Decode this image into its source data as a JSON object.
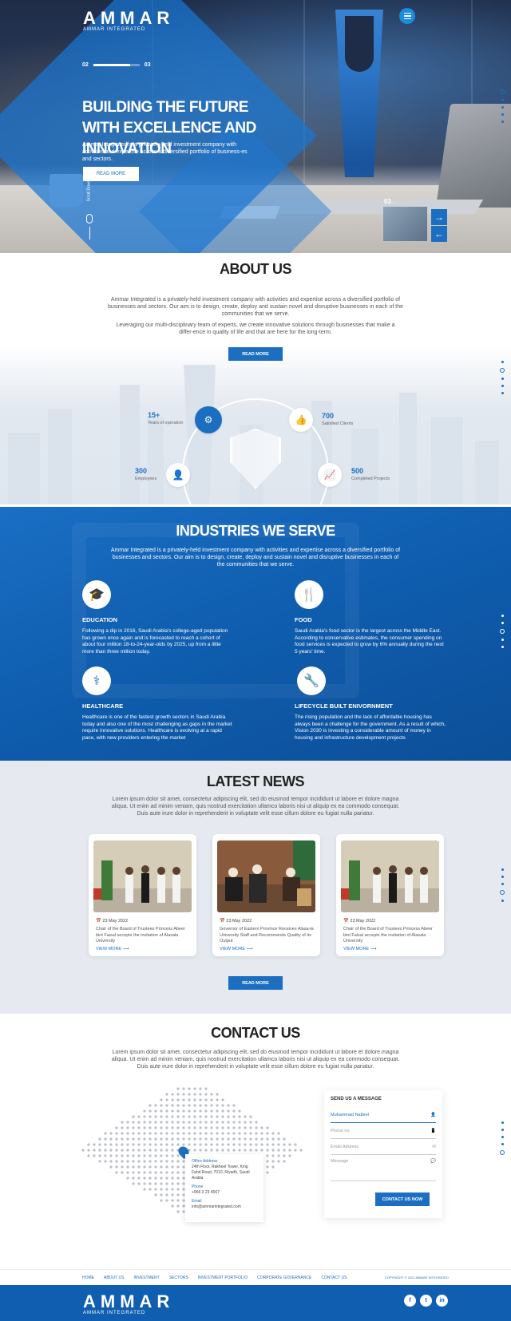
{
  "brand": {
    "name": "AMMAR",
    "tagline": "AMMAR INTEGRATED"
  },
  "hero": {
    "slide_current": "02",
    "slide_next": "03",
    "slide_progress": 0.8,
    "title": "Building the Future with Excellence and Innovation",
    "description": "Ammar Integrated is a privately-held investment company with activities and expertise across a diversified portfolio of business-es and sectors.",
    "cta": "READ MORE",
    "scroll_label": "Scroll Down",
    "thumb_number": "03 .",
    "next_icon": "arrow-right",
    "prev_icon": "arrow-left"
  },
  "about": {
    "title": "ABOUT US",
    "p1": "Ammar Integrated is a privately-held investment company with activities and expertise across a diversified portfolio of businesses and sectors. Our aim is to design, create, deploy and sustain novel and disruptive businesses in each of the communities that we serve.",
    "p2": "Leveraging our multi-disciplinary team of experts, we create innovative solutions through businesses that make a differ-ence in quality of life and that are here for the long-term.",
    "cta": "READ MORE",
    "stats": [
      {
        "value": "15+",
        "label": "Years of operation"
      },
      {
        "value": "700",
        "label": "Satisfied Clients"
      },
      {
        "value": "300",
        "label": "Employees"
      },
      {
        "value": "500",
        "label": "Completed Projects"
      }
    ]
  },
  "industries": {
    "title": "INDUSTRIES WE SERVE",
    "intro": "Ammar Integrated is a privately-held investment company with activities and expertise across a diversified portfolio of businesses and sectors. Our aim is to design, create, deploy and sustain novel and disruptive businesses in each of the communities that we serve.",
    "items": [
      {
        "title": "EDUCATION",
        "text": "Following a dip in 2016, Saudi Arabia's college-aged population has grown once again and is forecasted to reach a cohort of about four million 18-to-24-year-olds by 2025, up from a little more than three million today."
      },
      {
        "title": "FOOD",
        "text": "Saudi Arabia's food sector is the largest across the Middle East. According to conservative estimates, the consumer spending on food services is expected to grow by 6% annually during the next 5 years' time."
      },
      {
        "title": "HEALTHCARE",
        "text": "Healthcare is one of the fastest growth sectors in Saudi Arabia today and also one of the most challenging as gaps in the market require innovative solutions. Healthcare is evolving at a rapid pace, with new providers entering the market"
      },
      {
        "title": "LIFECYCLE BUILT ENIVORNMENT",
        "text": "The rising population and the lack of affordable housing has always been a challenge for the government. As a result of which, Vision 2030 is investing a considerable amount of money in housing and infrastructure development projects"
      }
    ]
  },
  "news": {
    "title": "LATEST NEWS",
    "intro": "Lorem ipsum dolor sit amet, consectetur adipiscing elit, sed do eiusmod tempor incididunt ut labore et dolore magna aliqua. Ut enim ad minim veniam, quis nostrud exercitation ullamco laboris nisi ut aliquip ex ea commodo consequat. Duis aute irure dolor in reprehenderit in voluptate velit esse cillum dolore eu fugiat nulla pariatur.",
    "cards": [
      {
        "date": "23 May 2022",
        "title": "Chair of the Board of Trustees Princess Abeer bint Faisal accepts the invitation of Alasala University",
        "more": "VIEW MORE"
      },
      {
        "date": "23 May 2022",
        "title": "Governor of Eastern Province Receives Alasa-la University Staff and Recommends Quality of its Output",
        "more": "VIEW MORE"
      },
      {
        "date": "23 May 2022",
        "title": "Chair of the Board of Trustees Princess Abeer bint Faisal accepts the invitation of Alasala University",
        "more": "VIEW MORE"
      }
    ],
    "cta": "READ MORE"
  },
  "contact": {
    "title": "CONTACT US",
    "intro": "Lorem ipsum dolor sit amet, consectetur adipiscing elit, sed do eiusmod tempor incididunt ut labore et dolore magna aliqua. Ut enim ad minim veniam, quis nostrud exercitation ullamco laboris nisi ut aliquip ex ea commodo consequat. Duis aute irure dolor in reprehenderit in voluptate velit esse cillum dolore eu fugiat nulla pariatur.",
    "office_label": "Office Address",
    "office_value": "24th Floor, Rakheel Tower, King Fahd Road, 7010, Riyadh, Saudi Arabia",
    "phone_label": "Phone",
    "phone_value": "+966 3 23 4567",
    "email_label": "Email",
    "email_value": "info@ammarintegrated.com",
    "form": {
      "heading": "SEND US A MESSAGE",
      "name_value": "Muhammad Nabeel",
      "phone_placeholder": "Phone no",
      "email_placeholder": "Email Address",
      "message_placeholder": "Message",
      "submit": "CONTACT US NOW"
    }
  },
  "footer": {
    "nav": [
      "HOME",
      "ABOUT US",
      "INVESTMENT",
      "SECTORS",
      "INVESTMENT PORTFOLIO",
      "CORPORATE GOVERNANCE",
      "CONTACT US"
    ],
    "copyright": "COPYRIGHT © 2022 AMMAR INTEGRATED",
    "social": [
      {
        "icon": "facebook-icon",
        "glyph": "f"
      },
      {
        "icon": "twitter-icon",
        "glyph": "t"
      },
      {
        "icon": "linkedin-icon",
        "glyph": "in"
      }
    ]
  },
  "colors": {
    "primary": "#1c6fc0",
    "dark_blue": "#0f5eb0",
    "light_bg": "#e6eaf0"
  }
}
